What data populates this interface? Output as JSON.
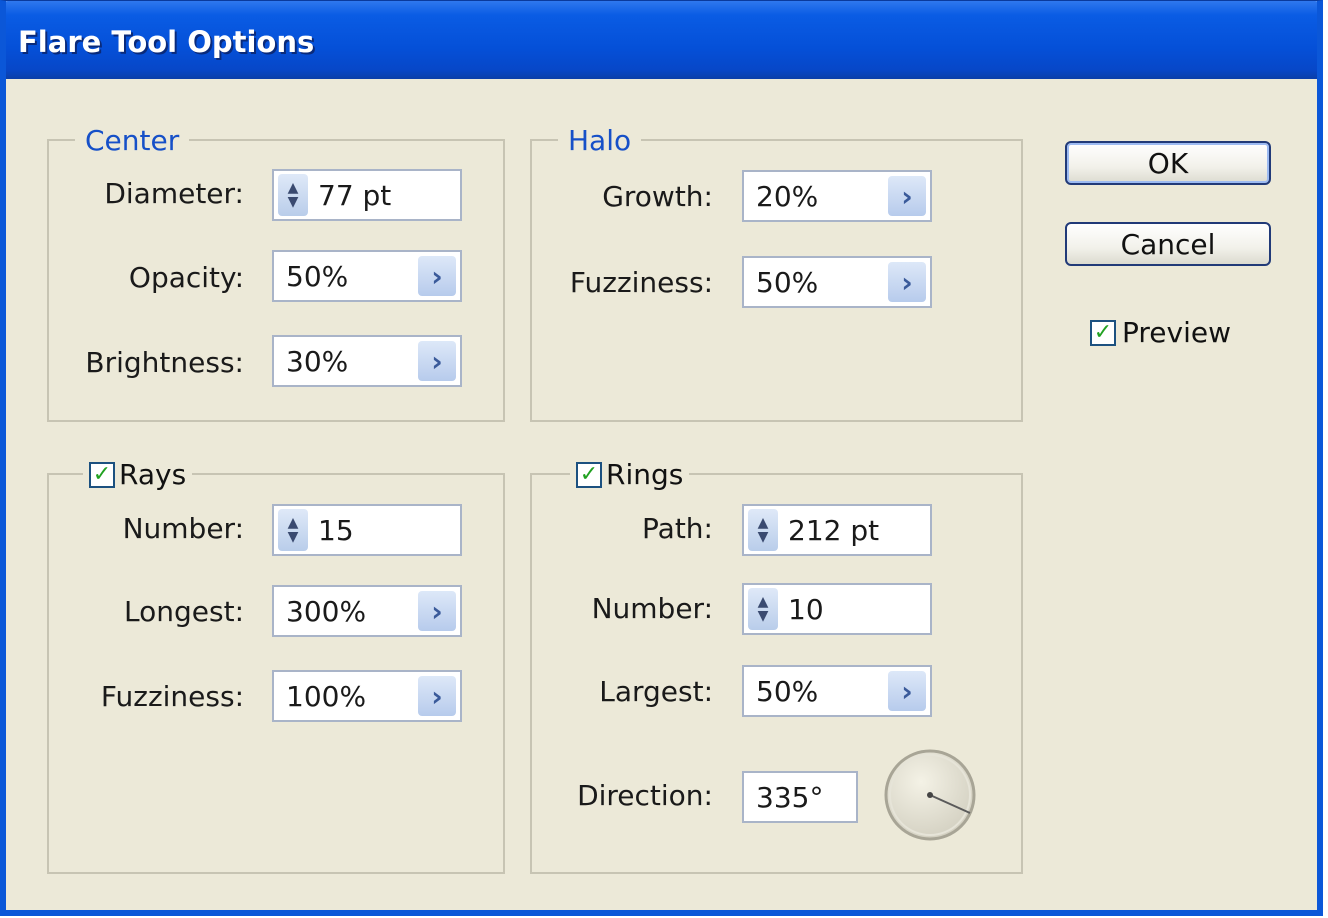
{
  "dialog": {
    "title": "Flare Tool Options"
  },
  "center": {
    "legend": "Center",
    "diameter": {
      "label": "Diameter:",
      "value": "77 pt"
    },
    "opacity": {
      "label": "Opacity:",
      "value": "50%"
    },
    "brightness": {
      "label": "Brightness:",
      "value": "30%"
    }
  },
  "halo": {
    "legend": "Halo",
    "growth": {
      "label": "Growth:",
      "value": "20%"
    },
    "fuzziness": {
      "label": "Fuzziness:",
      "value": "50%"
    }
  },
  "rays": {
    "legend": "Rays",
    "checked": true,
    "number": {
      "label": "Number:",
      "value": "15"
    },
    "longest": {
      "label": "Longest:",
      "value": "300%"
    },
    "fuzziness": {
      "label": "Fuzziness:",
      "value": "100%"
    }
  },
  "rings": {
    "legend": "Rings",
    "checked": true,
    "path": {
      "label": "Path:",
      "value": "212 pt"
    },
    "number": {
      "label": "Number:",
      "value": "10"
    },
    "largest": {
      "label": "Largest:",
      "value": "50%"
    },
    "direction": {
      "label": "Direction:",
      "value": "335°"
    }
  },
  "buttons": {
    "ok": "OK",
    "cancel": "Cancel"
  },
  "preview": {
    "label": "Preview",
    "checked": true
  },
  "icons": {
    "spinner": "up-down-spinner-icon",
    "popup": "chevron-right-icon",
    "check": "checkmark-icon",
    "dial": "angle-dial-icon"
  },
  "colors": {
    "titlebar": "#0550d8",
    "legend": "#1650c8",
    "background": "#ece9d8"
  }
}
